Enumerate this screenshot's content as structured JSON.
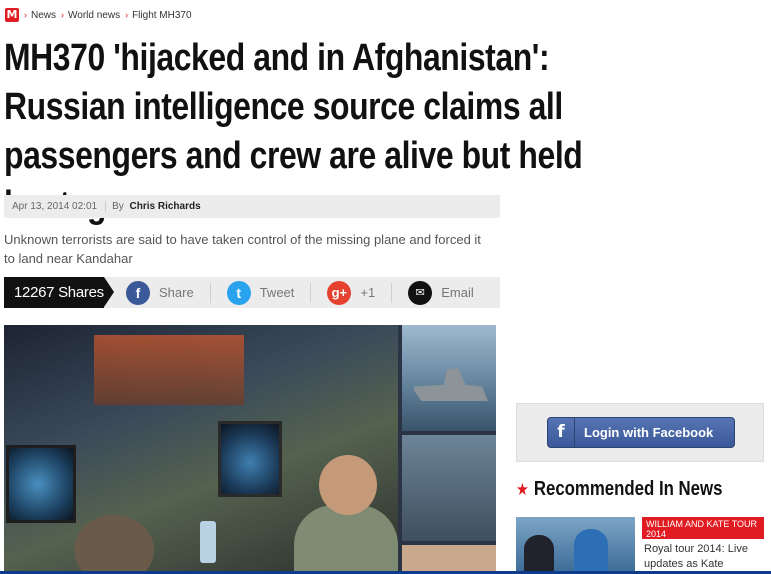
{
  "breadcrumb": {
    "logo": "M",
    "items": [
      "News",
      "World news",
      "Flight MH370"
    ]
  },
  "article": {
    "headline": "MH370 'hijacked and in Afghanistan': Russian intelligence source claims all passengers and crew are alive but held hostage",
    "date": "Apr 13, 2014 02:01",
    "by_label": "By",
    "author": "Chris Richards",
    "standfirst": "Unknown terrorists are said to have taken control of the missing plane and forced it to land near Kandahar"
  },
  "share_bar": {
    "shares": "12267 Shares",
    "facebook": "Share",
    "twitter": "Tweet",
    "google": "+1",
    "email": "Email"
  },
  "icons": {
    "facebook": "facebook-icon",
    "twitter": "twitter-icon",
    "google": "google-plus-icon",
    "email": "email-icon",
    "star": "star-icon"
  },
  "sidebar": {
    "facebook_login": "Login with Facebook",
    "recommended_title": "Recommended In News",
    "recommended": [
      {
        "kicker": "WILLIAM AND KATE TOUR 2014",
        "title": "Royal tour 2014: Live updates as Kate"
      }
    ]
  },
  "colors": {
    "brand_red": "#e01b22",
    "facebook_blue": "#3b5998",
    "twitter_blue": "#2aa3ef",
    "google_red": "#e5412f"
  }
}
